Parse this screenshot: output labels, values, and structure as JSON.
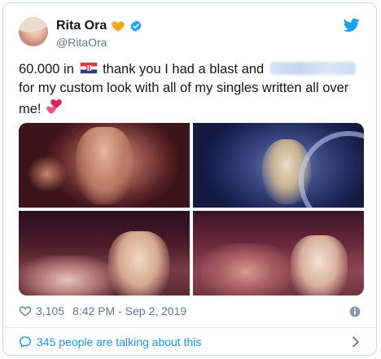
{
  "tweet": {
    "author": {
      "display_name": "Rita Ora",
      "handle": "@RitaOra"
    },
    "text": {
      "part1": "60.000 in",
      "part2": "thank you I had a blast and",
      "part3": "for my custom look with all of my singles written all over me!"
    },
    "likes": "3,105",
    "time": "8:42 PM",
    "separator": "-",
    "date": "Sep 2, 2019",
    "talking": "345 people are talking about this"
  },
  "colors": {
    "accent": "#1b95e0",
    "verified": "#1da1f2",
    "heart_emoji": "#f5a623",
    "muted": "#657786"
  },
  "icons": [
    "twitter-bird-icon",
    "orange-heart-icon",
    "verified-badge-icon",
    "croatia-flag-icon",
    "two-hearts-icon",
    "heart-outline-icon",
    "info-icon",
    "comment-bubble-icon",
    "chevron-right-icon"
  ]
}
